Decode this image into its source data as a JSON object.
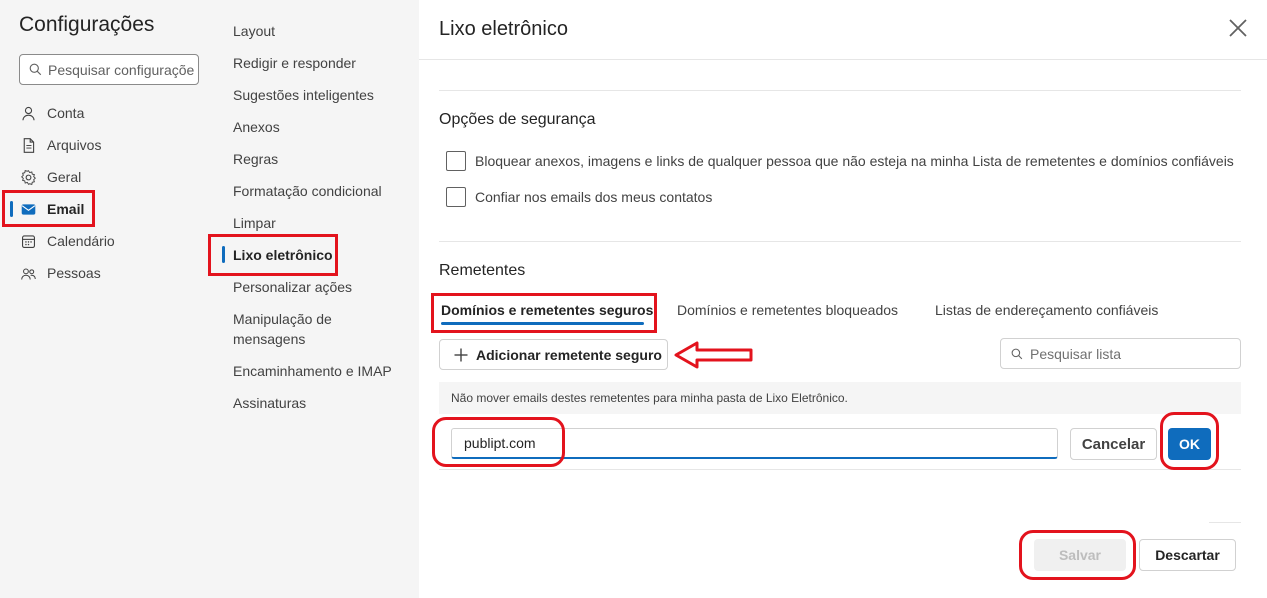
{
  "settings": {
    "title": "Configurações",
    "search_placeholder": "Pesquisar configuraçõe",
    "categories": [
      {
        "label": "Conta",
        "icon": "person-icon"
      },
      {
        "label": "Arquivos",
        "icon": "document-icon"
      },
      {
        "label": "Geral",
        "icon": "gear-icon"
      },
      {
        "label": "Email",
        "icon": "mail-icon",
        "active": true
      },
      {
        "label": "Calendário",
        "icon": "calendar-icon"
      },
      {
        "label": "Pessoas",
        "icon": "people-icon"
      }
    ]
  },
  "email_nav": {
    "items": [
      {
        "label": "Layout"
      },
      {
        "label": "Redigir e responder"
      },
      {
        "label": "Sugestões inteligentes"
      },
      {
        "label": "Anexos"
      },
      {
        "label": "Regras"
      },
      {
        "label": "Formatação condicional"
      },
      {
        "label": "Limpar"
      },
      {
        "label": "Lixo eletrônico",
        "active": true
      },
      {
        "label": "Personalizar ações"
      },
      {
        "label": "Manipulação de mensagens"
      },
      {
        "label": "Encaminhamento e IMAP"
      },
      {
        "label": "Assinaturas"
      }
    ]
  },
  "main": {
    "title": "Lixo eletrônico",
    "security": {
      "title": "Opções de segurança",
      "options": [
        {
          "label": "Bloquear anexos, imagens e links de qualquer pessoa que não esteja na minha Lista de remetentes e domínios confiáveis",
          "checked": false
        },
        {
          "label": "Confiar nos emails dos meus contatos",
          "checked": false
        }
      ]
    },
    "senders": {
      "title": "Remetentes",
      "tabs": [
        {
          "label": "Domínios e remetentes seguros",
          "active": true
        },
        {
          "label": "Domínios e remetentes bloqueados"
        },
        {
          "label": "Listas de endereçamento confiáveis"
        }
      ],
      "add_button": "Adicionar remetente seguro",
      "search_placeholder": "Pesquisar lista",
      "info": "Não mover emails destes remetentes para minha pasta de Lixo Eletrônico.",
      "entry_value": "publipt.com",
      "cancel": "Cancelar",
      "ok": "OK"
    },
    "save": "Salvar",
    "discard": "Descartar"
  },
  "colors": {
    "accent": "#0f6cbd",
    "annotation": "#e3131d"
  }
}
